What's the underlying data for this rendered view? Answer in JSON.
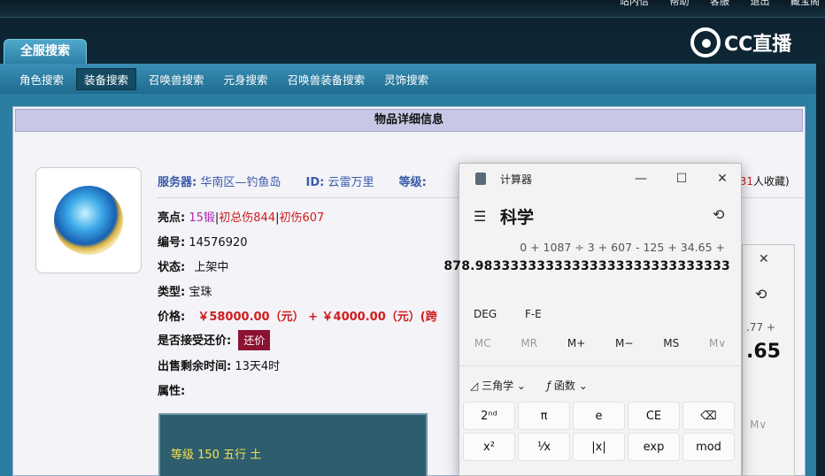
{
  "topbar": {
    "links": [
      "站内信",
      "帮助",
      "客服",
      "退出",
      "藏宝阁"
    ]
  },
  "main_tab": "全服搜索",
  "logo_text": "CC直播",
  "subnav": [
    "角色搜索",
    "装备搜索",
    "召唤兽搜索",
    "元身搜索",
    "召唤兽装备搜索",
    "灵饰搜索"
  ],
  "panel_title": "物品详细信息",
  "server_label": "服务器:",
  "server_value": "华南区—钓鱼岛",
  "id_label": "ID:",
  "id_value": "云雷万里",
  "level_label": "等级:",
  "fav_prefix": "(",
  "fav_count": "31",
  "fav_suffix": "人收藏)",
  "highlight_label": "亮点:",
  "highlight_a": "15锻",
  "highlight_b": "初总伤844",
  "highlight_c": "初伤607",
  "number_label": "编号:",
  "number_value": "14576920",
  "status_label": "状态:",
  "status_value": "上架中",
  "type_label": "类型:",
  "type_value": "宝珠",
  "price_label": "价格:",
  "price_value": "￥58000.00（元） + ￥4000.00（元）(跨",
  "bargain_label": "是否接受还价:",
  "bargain_button": "还价",
  "time_label": "出售剩余时间:",
  "time_value": "13天4时",
  "attr_label": "属性:",
  "attr_box_text": "等级 150 五行 土",
  "calc": {
    "app_name": "计算器",
    "mode": "科学",
    "expression": "0 + 1087 ÷ 3 + 607 - 125 + 34.65 +",
    "display": "878.98333333333333333333333333333",
    "row1": [
      "DEG",
      "F-E"
    ],
    "memory": [
      "MC",
      "MR",
      "M+",
      "M−",
      "MS",
      "M∨"
    ],
    "trig": "三角学",
    "func": "函数",
    "keys": [
      "2ⁿᵈ",
      "π",
      "e",
      "CE",
      "⌫",
      "x²",
      "¹⁄x",
      "|x|",
      "exp",
      "mod"
    ]
  },
  "calc_back": {
    "expr_fragment": ".77 +",
    "value_fragment": ".65",
    "m_label": "M∨"
  }
}
